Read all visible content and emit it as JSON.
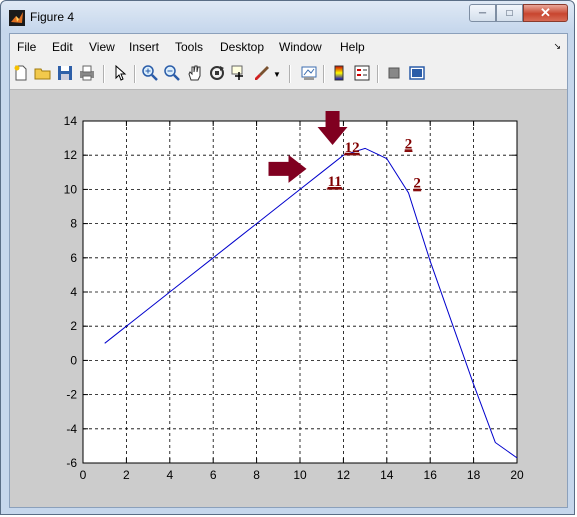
{
  "window": {
    "title": "Figure 4"
  },
  "menu": [
    "File",
    "Edit",
    "View",
    "Insert",
    "Tools",
    "Desktop",
    "Window",
    "Help"
  ],
  "toolbar_icons": [
    "new-figure-icon",
    "open-icon",
    "save-icon",
    "print-icon",
    "pointer-icon",
    "zoom-in-icon",
    "zoom-out-icon",
    "pan-hand-icon",
    "rotate-3d-icon",
    "data-cursor-icon",
    "brush-icon",
    "brush-dropdown-icon",
    "link-plot-icon",
    "colorbar-icon",
    "legend-icon",
    "hide-plot-tools-icon",
    "show-plot-tools-icon"
  ],
  "colors": {
    "line": "#0000cc",
    "annotation": "#800000",
    "arrow": "#800020"
  },
  "chart_data": {
    "type": "line",
    "x": [
      1,
      2,
      3,
      4,
      5,
      6,
      7,
      8,
      9,
      10,
      11,
      12,
      13,
      14,
      15,
      16,
      17,
      18,
      19,
      20
    ],
    "series": [
      {
        "values": [
          1,
          2,
          3,
          4,
          5,
          6,
          7,
          8,
          9,
          10,
          11,
          12,
          12.4,
          11.8,
          9.8,
          5.8,
          2.2,
          -1.4,
          -4.8,
          -5.7
        ]
      }
    ],
    "xlim": [
      0,
      20
    ],
    "ylim": [
      -6,
      14
    ],
    "xticks": [
      "0",
      "2",
      "4",
      "6",
      "8",
      "10",
      "12",
      "14",
      "16",
      "18",
      "20"
    ],
    "yticks": [
      "14",
      "12",
      "10",
      "8",
      "6",
      "4",
      "2",
      "0",
      "-2",
      "-4",
      "-6"
    ],
    "grid": true,
    "annotations": [
      {
        "text": "12",
        "x": 12.4,
        "y": 12.2
      },
      {
        "text": "11",
        "x": 11.6,
        "y": 10.2
      },
      {
        "text": "2",
        "x": 15.0,
        "y": 12.4
      },
      {
        "text": "2",
        "x": 15.4,
        "y": 10.1
      }
    ],
    "arrows": [
      {
        "direction": "down",
        "x": 11.5,
        "y": 12.6
      },
      {
        "direction": "right",
        "x": 10.3,
        "y": 11.2
      }
    ]
  }
}
